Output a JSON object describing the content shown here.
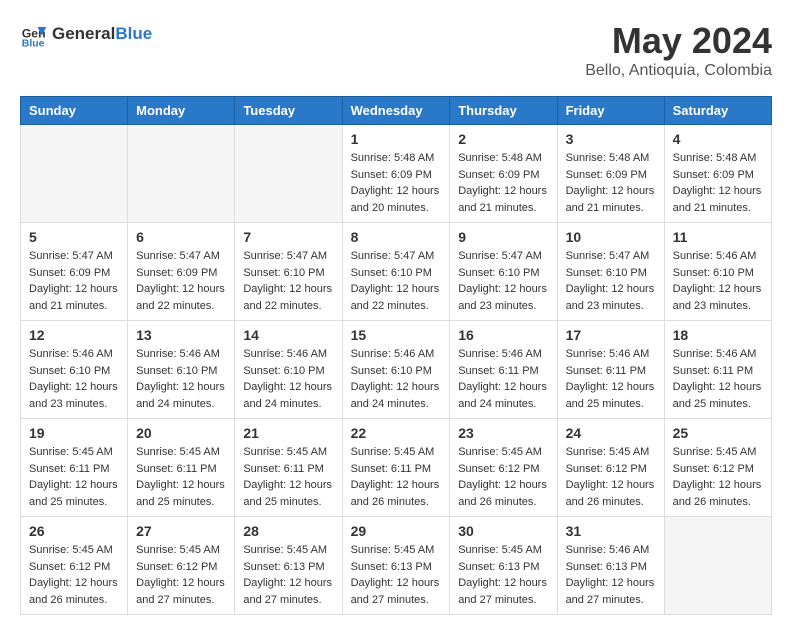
{
  "header": {
    "logo_general": "General",
    "logo_blue": "Blue",
    "month_title": "May 2024",
    "location": "Bello, Antioquia, Colombia"
  },
  "weekdays": [
    "Sunday",
    "Monday",
    "Tuesday",
    "Wednesday",
    "Thursday",
    "Friday",
    "Saturday"
  ],
  "weeks": [
    [
      {
        "day": "",
        "empty": true
      },
      {
        "day": "",
        "empty": true
      },
      {
        "day": "",
        "empty": true
      },
      {
        "day": "1",
        "sunrise": "Sunrise: 5:48 AM",
        "sunset": "Sunset: 6:09 PM",
        "daylight": "Daylight: 12 hours and 20 minutes."
      },
      {
        "day": "2",
        "sunrise": "Sunrise: 5:48 AM",
        "sunset": "Sunset: 6:09 PM",
        "daylight": "Daylight: 12 hours and 21 minutes."
      },
      {
        "day": "3",
        "sunrise": "Sunrise: 5:48 AM",
        "sunset": "Sunset: 6:09 PM",
        "daylight": "Daylight: 12 hours and 21 minutes."
      },
      {
        "day": "4",
        "sunrise": "Sunrise: 5:48 AM",
        "sunset": "Sunset: 6:09 PM",
        "daylight": "Daylight: 12 hours and 21 minutes."
      }
    ],
    [
      {
        "day": "5",
        "sunrise": "Sunrise: 5:47 AM",
        "sunset": "Sunset: 6:09 PM",
        "daylight": "Daylight: 12 hours and 21 minutes."
      },
      {
        "day": "6",
        "sunrise": "Sunrise: 5:47 AM",
        "sunset": "Sunset: 6:09 PM",
        "daylight": "Daylight: 12 hours and 22 minutes."
      },
      {
        "day": "7",
        "sunrise": "Sunrise: 5:47 AM",
        "sunset": "Sunset: 6:10 PM",
        "daylight": "Daylight: 12 hours and 22 minutes."
      },
      {
        "day": "8",
        "sunrise": "Sunrise: 5:47 AM",
        "sunset": "Sunset: 6:10 PM",
        "daylight": "Daylight: 12 hours and 22 minutes."
      },
      {
        "day": "9",
        "sunrise": "Sunrise: 5:47 AM",
        "sunset": "Sunset: 6:10 PM",
        "daylight": "Daylight: 12 hours and 23 minutes."
      },
      {
        "day": "10",
        "sunrise": "Sunrise: 5:47 AM",
        "sunset": "Sunset: 6:10 PM",
        "daylight": "Daylight: 12 hours and 23 minutes."
      },
      {
        "day": "11",
        "sunrise": "Sunrise: 5:46 AM",
        "sunset": "Sunset: 6:10 PM",
        "daylight": "Daylight: 12 hours and 23 minutes."
      }
    ],
    [
      {
        "day": "12",
        "sunrise": "Sunrise: 5:46 AM",
        "sunset": "Sunset: 6:10 PM",
        "daylight": "Daylight: 12 hours and 23 minutes."
      },
      {
        "day": "13",
        "sunrise": "Sunrise: 5:46 AM",
        "sunset": "Sunset: 6:10 PM",
        "daylight": "Daylight: 12 hours and 24 minutes."
      },
      {
        "day": "14",
        "sunrise": "Sunrise: 5:46 AM",
        "sunset": "Sunset: 6:10 PM",
        "daylight": "Daylight: 12 hours and 24 minutes."
      },
      {
        "day": "15",
        "sunrise": "Sunrise: 5:46 AM",
        "sunset": "Sunset: 6:10 PM",
        "daylight": "Daylight: 12 hours and 24 minutes."
      },
      {
        "day": "16",
        "sunrise": "Sunrise: 5:46 AM",
        "sunset": "Sunset: 6:11 PM",
        "daylight": "Daylight: 12 hours and 24 minutes."
      },
      {
        "day": "17",
        "sunrise": "Sunrise: 5:46 AM",
        "sunset": "Sunset: 6:11 PM",
        "daylight": "Daylight: 12 hours and 25 minutes."
      },
      {
        "day": "18",
        "sunrise": "Sunrise: 5:46 AM",
        "sunset": "Sunset: 6:11 PM",
        "daylight": "Daylight: 12 hours and 25 minutes."
      }
    ],
    [
      {
        "day": "19",
        "sunrise": "Sunrise: 5:45 AM",
        "sunset": "Sunset: 6:11 PM",
        "daylight": "Daylight: 12 hours and 25 minutes."
      },
      {
        "day": "20",
        "sunrise": "Sunrise: 5:45 AM",
        "sunset": "Sunset: 6:11 PM",
        "daylight": "Daylight: 12 hours and 25 minutes."
      },
      {
        "day": "21",
        "sunrise": "Sunrise: 5:45 AM",
        "sunset": "Sunset: 6:11 PM",
        "daylight": "Daylight: 12 hours and 25 minutes."
      },
      {
        "day": "22",
        "sunrise": "Sunrise: 5:45 AM",
        "sunset": "Sunset: 6:11 PM",
        "daylight": "Daylight: 12 hours and 26 minutes."
      },
      {
        "day": "23",
        "sunrise": "Sunrise: 5:45 AM",
        "sunset": "Sunset: 6:12 PM",
        "daylight": "Daylight: 12 hours and 26 minutes."
      },
      {
        "day": "24",
        "sunrise": "Sunrise: 5:45 AM",
        "sunset": "Sunset: 6:12 PM",
        "daylight": "Daylight: 12 hours and 26 minutes."
      },
      {
        "day": "25",
        "sunrise": "Sunrise: 5:45 AM",
        "sunset": "Sunset: 6:12 PM",
        "daylight": "Daylight: 12 hours and 26 minutes."
      }
    ],
    [
      {
        "day": "26",
        "sunrise": "Sunrise: 5:45 AM",
        "sunset": "Sunset: 6:12 PM",
        "daylight": "Daylight: 12 hours and 26 minutes."
      },
      {
        "day": "27",
        "sunrise": "Sunrise: 5:45 AM",
        "sunset": "Sunset: 6:12 PM",
        "daylight": "Daylight: 12 hours and 27 minutes."
      },
      {
        "day": "28",
        "sunrise": "Sunrise: 5:45 AM",
        "sunset": "Sunset: 6:13 PM",
        "daylight": "Daylight: 12 hours and 27 minutes."
      },
      {
        "day": "29",
        "sunrise": "Sunrise: 5:45 AM",
        "sunset": "Sunset: 6:13 PM",
        "daylight": "Daylight: 12 hours and 27 minutes."
      },
      {
        "day": "30",
        "sunrise": "Sunrise: 5:45 AM",
        "sunset": "Sunset: 6:13 PM",
        "daylight": "Daylight: 12 hours and 27 minutes."
      },
      {
        "day": "31",
        "sunrise": "Sunrise: 5:46 AM",
        "sunset": "Sunset: 6:13 PM",
        "daylight": "Daylight: 12 hours and 27 minutes."
      },
      {
        "day": "",
        "empty": true
      }
    ]
  ]
}
